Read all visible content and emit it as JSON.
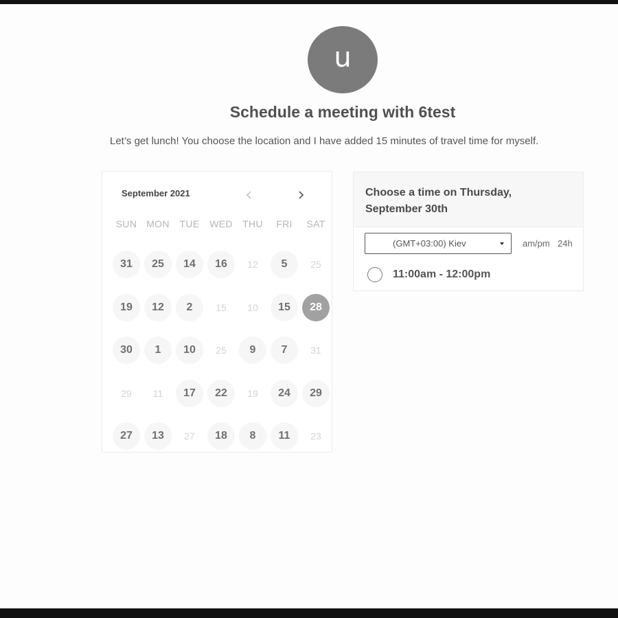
{
  "host": {
    "avatar_letter": "u",
    "title": "Schedule a meeting with 6test",
    "description": "Let’s get lunch! You choose the location and I have added 15 minutes of travel time for myself."
  },
  "calendar": {
    "month_label": "September 2021",
    "prev_icon": "chevron-left-icon",
    "next_icon": "chevron-right-icon",
    "weekdays": [
      "SUN",
      "MON",
      "TUE",
      "WED",
      "THU",
      "FRI",
      "SAT"
    ],
    "days": [
      {
        "label": "31",
        "state": "available"
      },
      {
        "label": "25",
        "state": "available"
      },
      {
        "label": "14",
        "state": "available"
      },
      {
        "label": "16",
        "state": "available"
      },
      {
        "label": "12",
        "state": "unavailable"
      },
      {
        "label": "5",
        "state": "available"
      },
      {
        "label": "25",
        "state": "unavailable"
      },
      {
        "label": "19",
        "state": "available"
      },
      {
        "label": "12",
        "state": "available"
      },
      {
        "label": "2",
        "state": "available"
      },
      {
        "label": "15",
        "state": "unavailable"
      },
      {
        "label": "10",
        "state": "unavailable"
      },
      {
        "label": "15",
        "state": "available"
      },
      {
        "label": "28",
        "state": "selected"
      },
      {
        "label": "30",
        "state": "available"
      },
      {
        "label": "1",
        "state": "available"
      },
      {
        "label": "10",
        "state": "available"
      },
      {
        "label": "25",
        "state": "unavailable"
      },
      {
        "label": "9",
        "state": "available"
      },
      {
        "label": "7",
        "state": "available"
      },
      {
        "label": "31",
        "state": "unavailable"
      },
      {
        "label": "29",
        "state": "unavailable"
      },
      {
        "label": "11",
        "state": "unavailable"
      },
      {
        "label": "17",
        "state": "available"
      },
      {
        "label": "22",
        "state": "available"
      },
      {
        "label": "19",
        "state": "unavailable"
      },
      {
        "label": "24",
        "state": "available"
      },
      {
        "label": "29",
        "state": "available"
      },
      {
        "label": "27",
        "state": "available"
      },
      {
        "label": "13",
        "state": "available"
      },
      {
        "label": "27",
        "state": "unavailable"
      },
      {
        "label": "18",
        "state": "available"
      },
      {
        "label": "8",
        "state": "available"
      },
      {
        "label": "11",
        "state": "available"
      },
      {
        "label": "23",
        "state": "unavailable"
      }
    ]
  },
  "times": {
    "heading": "Choose a time on Thursday, September 30th",
    "timezone": "(GMT+03:00) Kiev",
    "format_ampm": "am/pm",
    "format_24h": "24h",
    "slots": [
      {
        "label": "11:00am - 12:00pm"
      }
    ]
  }
}
